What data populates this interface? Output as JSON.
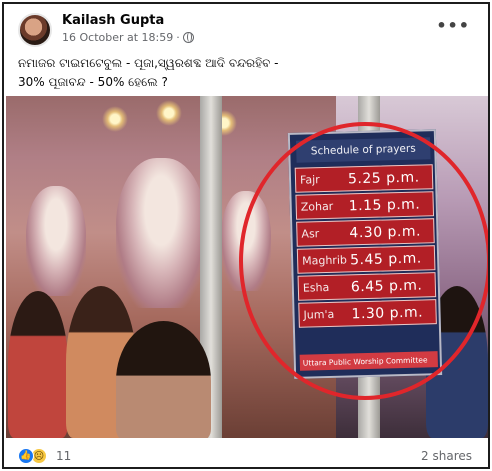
{
  "post": {
    "author": "Kailash Gupta",
    "date": "16 October at 18:59",
    "separator": "·",
    "text_line1": "ନମାଜର ଟାଇମଟେବୁଲ - ପୂଜା,ସ୍ୱରଶବ୍ଦ ଆଦି ବନ୍ଦରହିବ -",
    "text_line2": "30% ପୂଜାବନ୍ଦ - 50% ହେଲେ ?",
    "more_glyph": "•••"
  },
  "photo": {
    "board_title": "Schedule of prayers",
    "prayers": [
      {
        "name": "Fajr",
        "time": "5.25 p.m."
      },
      {
        "name": "Zohar",
        "time": "1.15 p.m."
      },
      {
        "name": "Asr",
        "time": "4.30 p.m."
      },
      {
        "name": "Maghrib",
        "time": "5.45 p.m."
      },
      {
        "name": "Esha",
        "time": "6.45 p.m."
      },
      {
        "name": "Jum'a",
        "time": "1.30 p.m."
      }
    ],
    "board_footer": "Uttara Public Worship Committee",
    "highlight_color": "#e0262b"
  },
  "footer": {
    "reaction_count": "11",
    "shares": "2 shares",
    "like_glyph": "👍",
    "sad_glyph": "☹"
  }
}
